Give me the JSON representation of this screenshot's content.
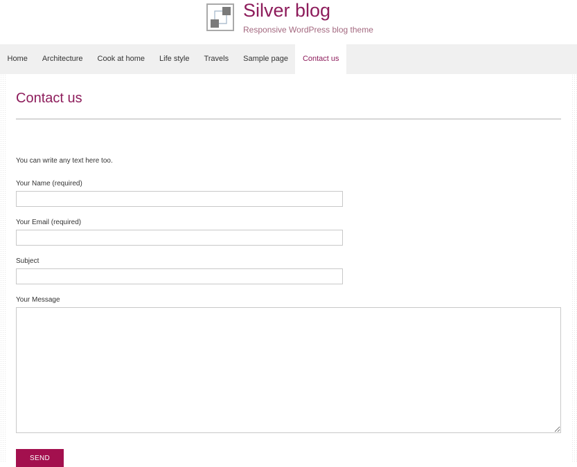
{
  "site": {
    "title": "Silver blog",
    "tagline": "Responsive WordPress blog theme",
    "logo_icon": "squares-logo-icon"
  },
  "nav": {
    "items": [
      {
        "label": "Home"
      },
      {
        "label": "Architecture"
      },
      {
        "label": "Cook at home"
      },
      {
        "label": "Life style"
      },
      {
        "label": "Travels"
      },
      {
        "label": "Sample page"
      },
      {
        "label": "Contact us",
        "active": true
      }
    ]
  },
  "page": {
    "title": "Contact us",
    "intro": "You can write any text here too."
  },
  "form": {
    "name_label": "Your Name (required)",
    "name_value": "",
    "email_label": "Your Email (required)",
    "email_value": "",
    "subject_label": "Subject",
    "subject_value": "",
    "message_label": "Your Message",
    "message_value": "",
    "send_label": "SEND"
  },
  "colors": {
    "brand": "#8d1c5b",
    "button": "#a3104e",
    "nav_background": "#f0f0f0"
  }
}
